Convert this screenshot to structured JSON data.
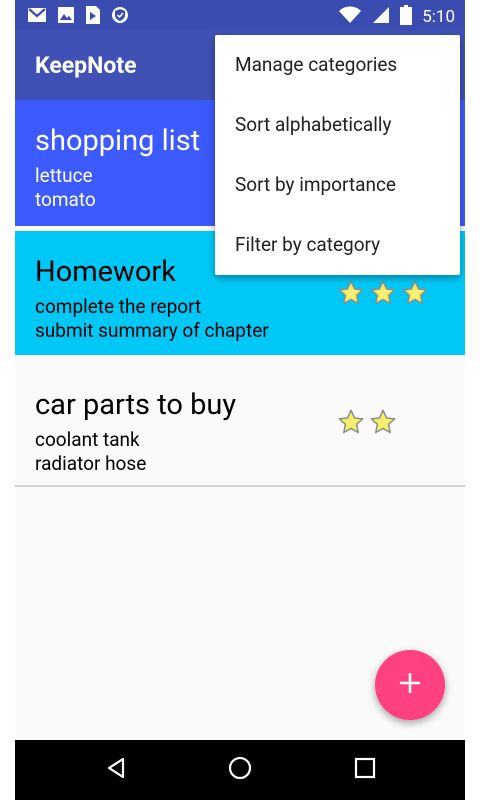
{
  "status_bar": {
    "time": "5:10",
    "left_icons": [
      "gmail-icon",
      "gallery-icon",
      "play-store-icon",
      "shield-icon"
    ],
    "right_icons": [
      "wifi-icon",
      "signal-icon",
      "battery-icon"
    ]
  },
  "app_bar": {
    "title": "KeepNote"
  },
  "notes": [
    {
      "title": "shopping list",
      "lines": [
        "lettuce",
        "tomato"
      ],
      "color": "#3d5afe",
      "stars": 0
    },
    {
      "title": "Homework",
      "lines": [
        "complete the report",
        "submit summary of chapter"
      ],
      "color": "#00c8f6",
      "stars": 3
    },
    {
      "title": "car parts to buy",
      "lines": [
        "coolant tank",
        "radiator hose"
      ],
      "color": "#fafafa",
      "stars": 2
    }
  ],
  "menu": {
    "items": [
      {
        "label": "Manage categories"
      },
      {
        "label": "Sort alphabetically"
      },
      {
        "label": "Sort by importance"
      },
      {
        "label": "Filter by category"
      }
    ]
  },
  "fab": {
    "icon": "plus-icon",
    "color": "#ff4081"
  },
  "nav_bar": {
    "icons": [
      "back-icon",
      "home-icon",
      "recents-icon"
    ]
  },
  "colors": {
    "primary": "#3f51b5",
    "status_bar": "#3a4cb0",
    "star_fill": "#f5ef6c",
    "star_stroke": "#8d8d8d"
  }
}
